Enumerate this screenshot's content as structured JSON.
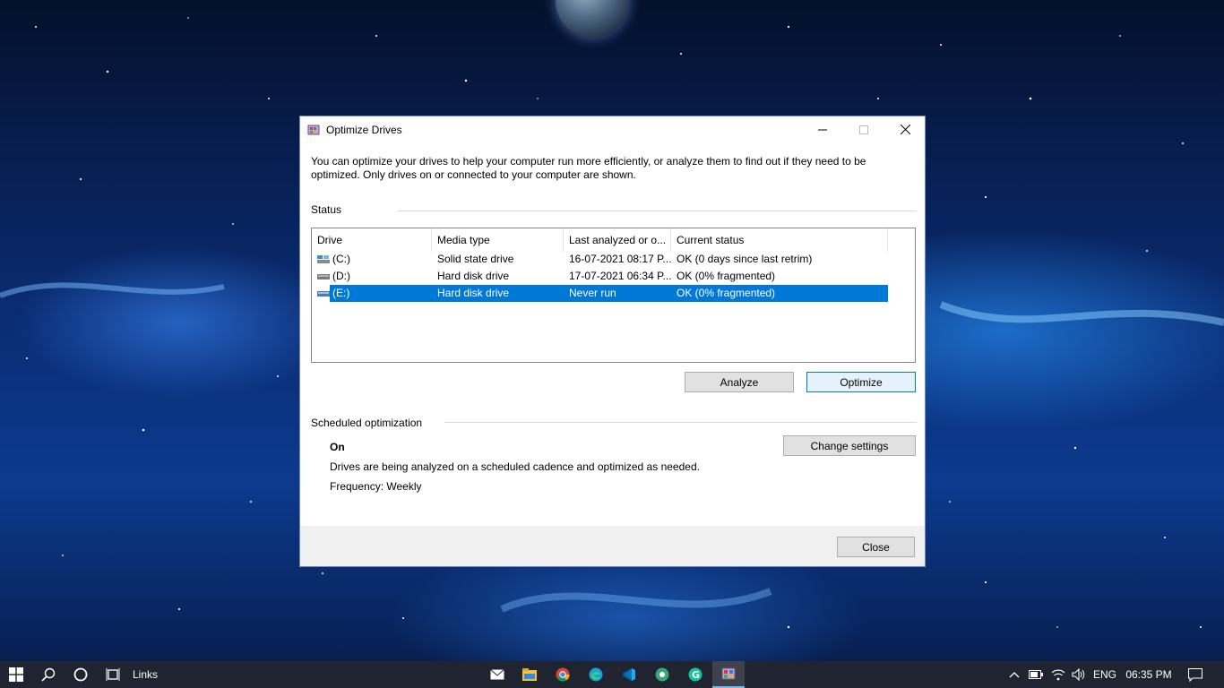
{
  "window": {
    "title": "Optimize Drives",
    "controls": {
      "minimize": "—",
      "maximize": "☐",
      "close": "✕"
    }
  },
  "intro": "You can optimize your drives to help your computer run more efficiently, or analyze them to find out if they need to be optimized. Only drives on or connected to your computer are shown.",
  "status_section": {
    "label": "Status",
    "columns": [
      "Drive",
      "Media type",
      "Last analyzed or o...",
      "Current status"
    ],
    "drives": [
      {
        "drive": "(C:)",
        "media": "Solid state drive",
        "last": "16-07-2021 08:17 P...",
        "status": "OK (0 days since last retrim)",
        "icon": "ssd-drive-icon"
      },
      {
        "drive": "(D:)",
        "media": "Hard disk drive",
        "last": "17-07-2021 06:34 P...",
        "status": "OK (0% fragmented)",
        "icon": "hdd-drive-icon"
      },
      {
        "drive": "(E:)",
        "media": "Hard disk drive",
        "last": "Never run",
        "status": "OK (0% fragmented)",
        "icon": "hdd-drive-icon",
        "selected": true
      }
    ],
    "analyze_label": "Analyze",
    "optimize_label": "Optimize"
  },
  "scheduled": {
    "label": "Scheduled optimization",
    "state": "On",
    "description": "Drives are being analyzed on a scheduled cadence and optimized as needed.",
    "frequency": "Frequency: Weekly",
    "change_label": "Change settings"
  },
  "close_label": "Close",
  "taskbar": {
    "links_label": "Links",
    "language": "ENG",
    "time": "06:35 PM",
    "apps": [
      "mail-icon",
      "file-explorer-icon",
      "chrome-icon",
      "edge-icon",
      "vscode-icon",
      "app-icon",
      "grammarly-icon",
      "defrag-icon"
    ]
  },
  "colors": {
    "selection": "#0078d7",
    "taskbar": "#1f2430",
    "dialog_footer": "#f0f0f0"
  }
}
